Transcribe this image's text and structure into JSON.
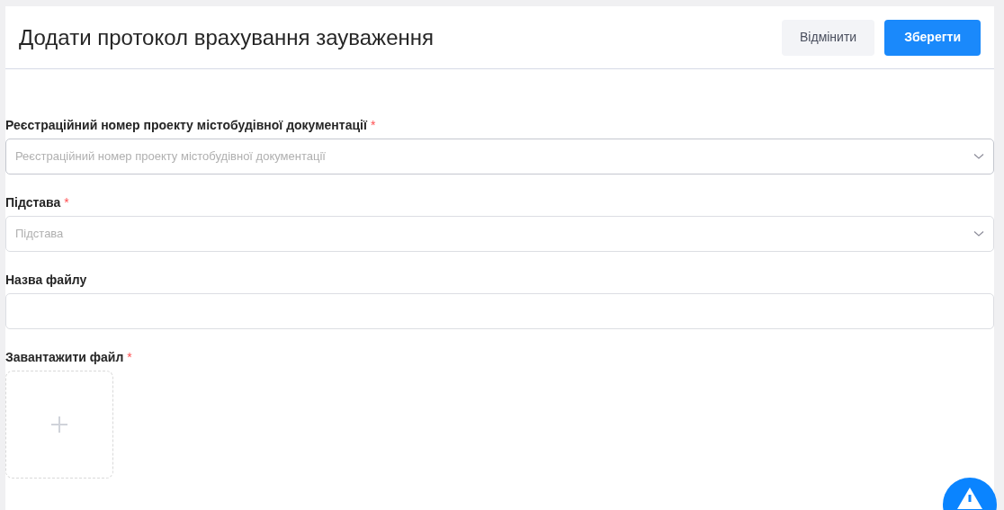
{
  "header": {
    "title": "Додати протокол врахування зауваження",
    "buttons": [
      {
        "label": "Відмінити",
        "kind": "secondary"
      },
      {
        "label": "Зберегти",
        "kind": "primary"
      }
    ]
  },
  "fields": [
    {
      "kind": "select",
      "label": "Реєстраційний номер проекту містобудівної документації",
      "required": true,
      "placeholder": "Реєстраційний номер проекту містобудівної документації"
    },
    {
      "kind": "select",
      "label": "Підстава",
      "required": true,
      "placeholder": "Підстава"
    },
    {
      "kind": "text",
      "label": "Назва файлу",
      "required": false
    },
    {
      "kind": "upload",
      "label": "Завантажити файл",
      "required": true
    }
  ],
  "required_mark": "*"
}
